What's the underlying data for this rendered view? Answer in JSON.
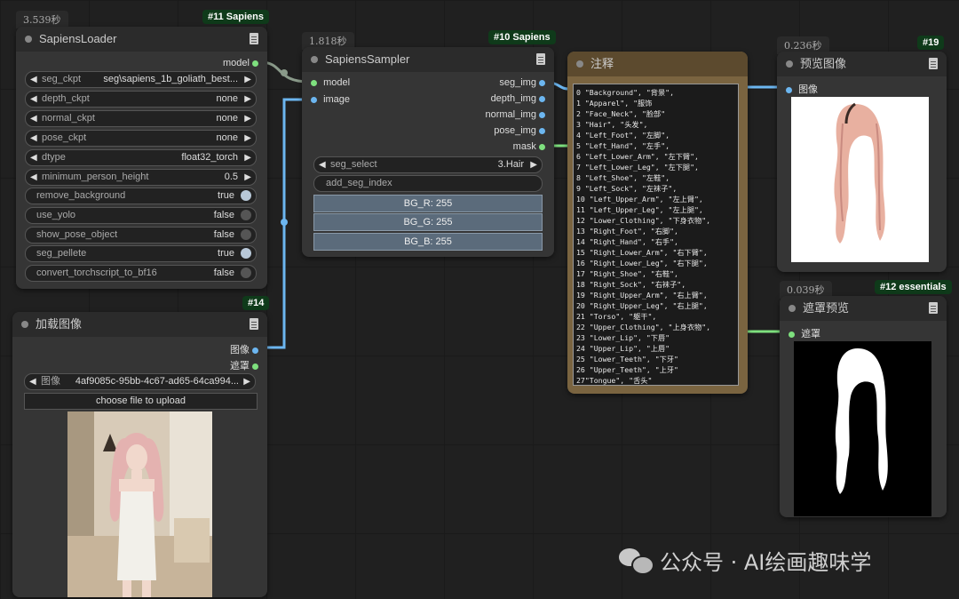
{
  "loader": {
    "time": "3.539秒",
    "id": "#11 Sapiens",
    "title": "SapiensLoader",
    "output": "model",
    "widgets": [
      {
        "label": "seg_ckpt",
        "value": "seg\\sapiens_1b_goliath_best..."
      },
      {
        "label": "depth_ckpt",
        "value": "none"
      },
      {
        "label": "normal_ckpt",
        "value": "none"
      },
      {
        "label": "pose_ckpt",
        "value": "none"
      },
      {
        "label": "dtype",
        "value": "float32_torch"
      },
      {
        "label": "minimum_person_height",
        "value": "0.5"
      }
    ],
    "toggles": [
      {
        "label": "remove_background",
        "value": "true"
      },
      {
        "label": "use_yolo",
        "value": "false"
      },
      {
        "label": "show_pose_object",
        "value": "false"
      },
      {
        "label": "seg_pellete",
        "value": "true"
      },
      {
        "label": "convert_torchscript_to_bf16",
        "value": "false"
      }
    ]
  },
  "sampler": {
    "time": "1.818秒",
    "id": "#10 Sapiens",
    "title": "SapiensSampler",
    "inputs": [
      "model",
      "image"
    ],
    "outputs": [
      "seg_img",
      "depth_img",
      "normal_img",
      "pose_img",
      "mask"
    ],
    "seg_select_label": "seg_select",
    "seg_select_value": "3.Hair",
    "add_seg_index": "add_seg_index",
    "bg_r": "BG_R: 255",
    "bg_g": "BG_G: 255",
    "bg_b": "BG_B: 255"
  },
  "note": {
    "title": "注释",
    "text": "0 \"Background\", \"背景\",\n1 \"Apparel\", \"服饰\n2 \"Face_Neck\", \"脸部\"\n3 \"Hair\", \"头发\",\n4 \"Left_Foot\", \"左脚\",\n5 \"Left_Hand\", \"左手\",\n6 \"Left_Lower_Arm\", \"左下臂\",\n7 \"Left_Lower_Leg\", \"左下腿\",\n8 \"Left_Shoe\", \"左鞋\",\n9 \"Left_Sock\", \"左袜子\",\n10 \"Left_Upper_Arm\", \"左上臂\",\n11 \"Left_Upper_Leg\", \"左上腿\",\n12 \"Lower_Clothing\", \"下身衣物\",\n13 \"Right_Foot\", \"右脚\",\n14 \"Right_Hand\", \"右手\",\n15 \"Right_Lower_Arm\", \"右下臂\",\n16 \"Right_Lower_Leg\", \"右下腿\",\n17 \"Right_Shoe\", \"右鞋\",\n18 \"Right_Sock\", \"右袜子\",\n19 \"Right_Upper_Arm\", \"右上臂\",\n20 \"Right_Upper_Leg\", \"右上腿\",\n21 \"Torso\", \"躯干\",\n22 \"Upper_Clothing\", \"上身衣物\",\n23 \"Lower_Lip\", \"下唇\"\n24 \"Upper_Lip\", \"上唇\"\n25 \"Lower_Teeth\", \"下牙\"\n26 \"Upper_Teeth\", \"上牙\"\n27\"Tongue\", \"舌头\""
  },
  "preview": {
    "time": "0.236秒",
    "id": "#19",
    "title": "预览图像",
    "input": "图像"
  },
  "maskpreview": {
    "time": "0.039秒",
    "id": "#12 essentials",
    "title": "遮罩预览",
    "input": "遮罩"
  },
  "loadimage": {
    "id": "#14",
    "title": "加载图像",
    "outputs": [
      "图像",
      "遮罩"
    ],
    "image_label": "图像",
    "image_value": "4af9085c-95bb-4c67-ad65-64ca994...",
    "upload": "choose file to upload"
  },
  "watermark": "公众号 · AI绘画趣味学",
  "colors": {
    "canvas": "#202020",
    "node": "#353535",
    "wire_blue": "#6cb6f0",
    "wire_green": "#7ee07e",
    "note_frame": "#7a6440"
  }
}
